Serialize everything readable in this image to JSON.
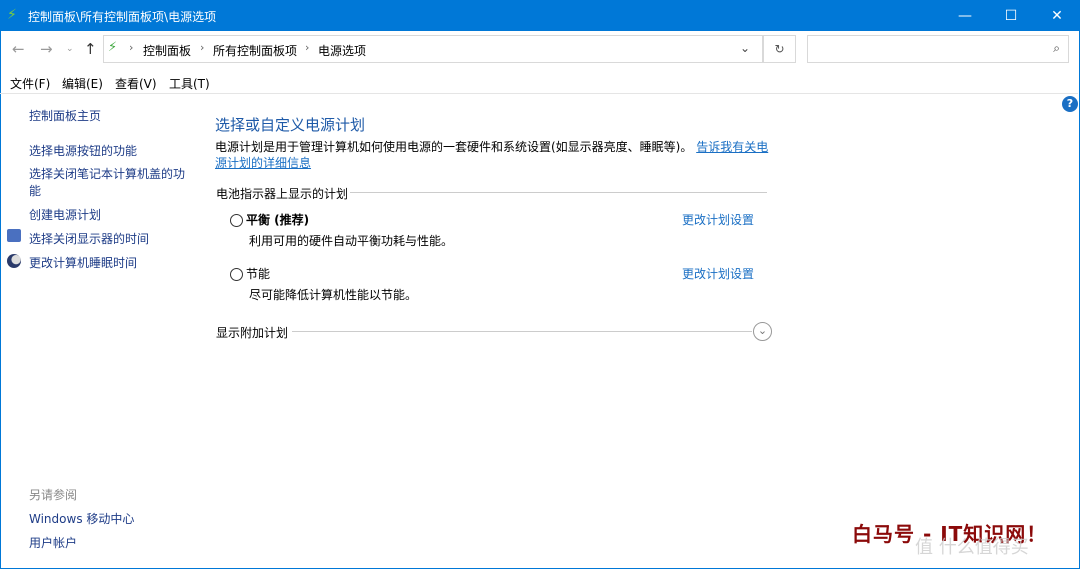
{
  "window": {
    "title": "控制面板\\所有控制面板项\\电源选项",
    "minimize": "—",
    "maximize": "☐",
    "close": "✕"
  },
  "address": {
    "crumbs": [
      "控制面板",
      "所有控制面板项",
      "电源选项"
    ],
    "search_placeholder": ""
  },
  "menu": [
    "文件(F)",
    "编辑(E)",
    "查看(V)",
    "工具(T)"
  ],
  "sidebar": {
    "home": "控制面板主页",
    "items": [
      "选择电源按钮的功能",
      "选择关闭笔记本计算机盖的功能",
      "创建电源计划",
      "选择关闭显示器的时间",
      "更改计算机睡眠时间"
    ],
    "see_also": "另请参阅",
    "see_also_items": [
      "Windows 移动中心",
      "用户帐户"
    ]
  },
  "main": {
    "title": "选择或自定义电源计划",
    "desc": "电源计划是用于管理计算机如何使用电源的一套硬件和系统设置(如显示器亮度、睡眠等)。",
    "desc_link": "告诉我有关电源计划的详细信息",
    "section": "电池指示器上显示的计划",
    "plans": [
      {
        "name": "平衡 (推荐)",
        "desc": "利用可用的硬件自动平衡功耗与性能。",
        "link": "更改计划设置"
      },
      {
        "name": "节能",
        "desc": "尽可能降低计算机性能以节能。",
        "link": "更改计划设置"
      }
    ],
    "more": "显示附加计划"
  },
  "watermark": {
    "text": "白马号 - IT知识网！",
    "brand": "值 什么值得买"
  }
}
